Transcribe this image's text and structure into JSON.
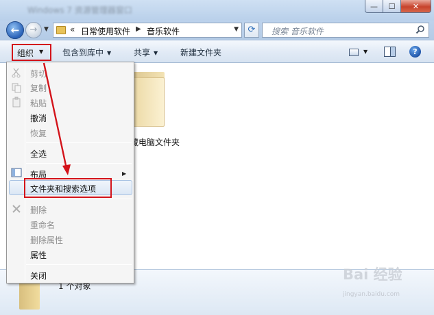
{
  "window": {
    "title_blurred": "Windows 7 资源管理器窗口",
    "controls": {
      "minimize": "—",
      "maximize": "☐",
      "close": "✕"
    }
  },
  "address": {
    "chevron": "«",
    "path": [
      "日常使用软件",
      "音乐软件"
    ],
    "separator": "▶",
    "dropdown": "▼",
    "refresh": "⟳"
  },
  "search": {
    "placeholder": "搜索 音乐软件"
  },
  "toolbar": {
    "organize": "组织",
    "include_library": "包含到库中",
    "share": "共享",
    "new_folder": "新建文件夹"
  },
  "content": {
    "folder_name": "藏电脑文件夹",
    "items_count": "1 个对象"
  },
  "menu": {
    "cut": "剪切",
    "copy": "复制",
    "paste": "粘贴",
    "undo": "撤消",
    "redo": "恢复",
    "select_all": "全选",
    "layout": "布局",
    "folder_options": "文件夹和搜索选项",
    "delete": "删除",
    "rename": "重命名",
    "remove_properties": "删除属性",
    "properties": "属性",
    "close": "关闭"
  },
  "watermark": {
    "main": "Bai 经验",
    "sub": "jingyan.baidu.com"
  },
  "colors": {
    "highlight_red": "#d3131a",
    "toolbar_bg": "#e2ebf6",
    "menu_bg": "#f5f5f5"
  }
}
